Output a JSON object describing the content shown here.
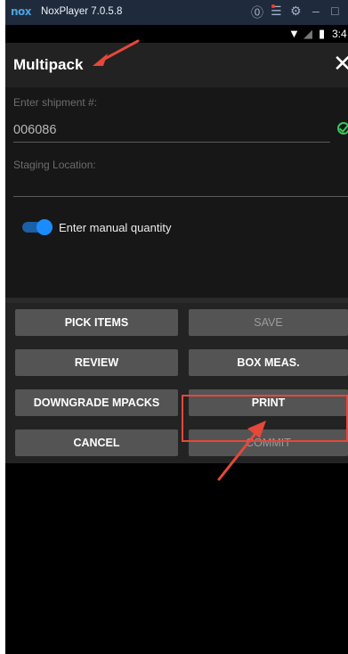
{
  "window": {
    "logo": "nox",
    "title": "NoxPlayer 7.0.5.8",
    "icons": [
      "help-icon",
      "menu-icon",
      "settings-icon",
      "minimize-icon",
      "close-window-icon"
    ]
  },
  "statusbar": {
    "time": "3:4"
  },
  "appbar": {
    "title": "Multipack",
    "close_glyph": "✕"
  },
  "form": {
    "shipment_label": "Enter shipment #:",
    "shipment_value": "006086",
    "staging_label": "Staging Location:",
    "staging_value": "",
    "manual_qty_label": "Enter manual quantity",
    "manual_qty_on": true
  },
  "buttons": {
    "pick_items": "PICK ITEMS",
    "save": "SAVE",
    "review": "REVIEW",
    "box_meas": "BOX MEAS.",
    "downgrade": "DOWNGRADE MPACKS",
    "print": "PRINT",
    "cancel": "CANCEL",
    "commit": "COMMIT"
  },
  "colors": {
    "annotation": "#e4483a",
    "toggle_accent": "#1a8cff",
    "valid_check": "#35c759"
  }
}
